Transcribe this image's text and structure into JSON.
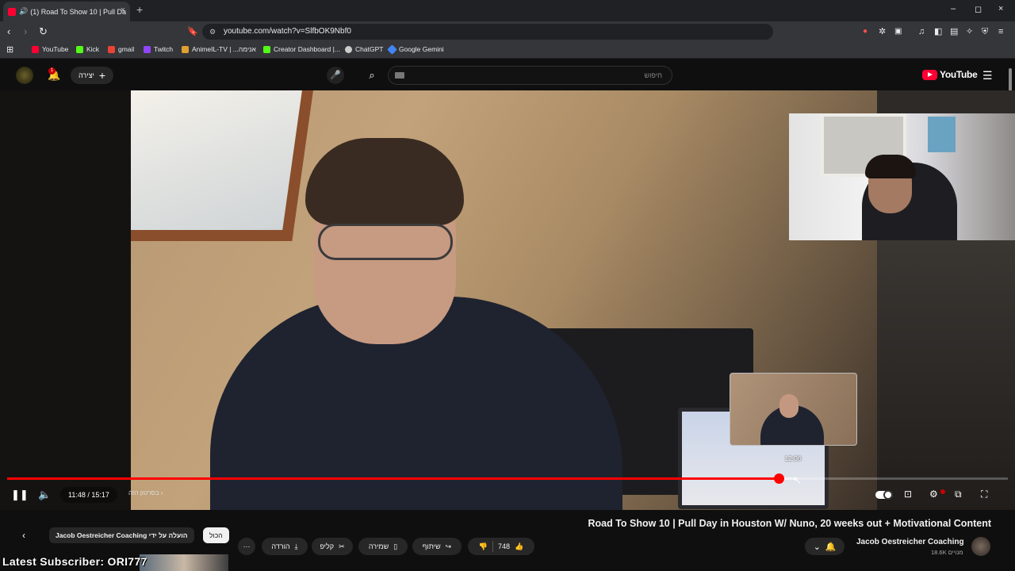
{
  "browser": {
    "tab_title": "(1) Road To Show 10 | Pull Da",
    "tab_close": "×",
    "new_tab": "+",
    "url": "youtube.com/watch?v=SlfbOK9Nbf0",
    "window_controls": [
      "–",
      "◻",
      "×"
    ],
    "bookmarks": [
      {
        "label": "YouTube",
        "color": "#ff0033"
      },
      {
        "label": "Kick",
        "color": "#53fc18"
      },
      {
        "label": "gmail",
        "color": "#ea4335"
      },
      {
        "label": "Twitch",
        "color": "#9146ff"
      },
      {
        "label": "AnimeIL-TV | ...אנימה",
        "color": "#e0a030"
      },
      {
        "label": "Creator Dashboard |...",
        "color": "#53fc18"
      },
      {
        "label": "ChatGPT",
        "color": "#cccccc"
      },
      {
        "label": "Google Gemini",
        "color": "#4285f4"
      }
    ]
  },
  "yt_header": {
    "logo_text": "YouTube",
    "search_placeholder": "חיפוש",
    "create_label": "יצירה",
    "notification_count": "1"
  },
  "player": {
    "current_time": "11:48",
    "duration": "15:17",
    "time_display": "11:48 / 15:17",
    "progress_fraction": 0.771,
    "hover_time": "12:06",
    "hover_fraction": 0.788,
    "chapter_label": "בסרטון הזה",
    "accent_color": "#ff0000"
  },
  "video": {
    "title": "Road To Show 10 | Pull Day in Houston W/ Nuno, 20 weeks out + Motivational Content",
    "channel_name": "Jacob Oestreicher Coaching",
    "subscribers": "18.6K מנויים",
    "likes": "748",
    "actions": {
      "share": "שיתוף",
      "save": "שמירה",
      "clip": "קליפ",
      "download": "הורדה",
      "more": "⋯"
    }
  },
  "chips": {
    "uploader_chip": "Jacob Oestreicher Coaching הועלה על ידי",
    "all_chip": "הכול"
  },
  "stream_overlay": {
    "latest_subscriber": "Latest Subscriber: ORI777"
  }
}
